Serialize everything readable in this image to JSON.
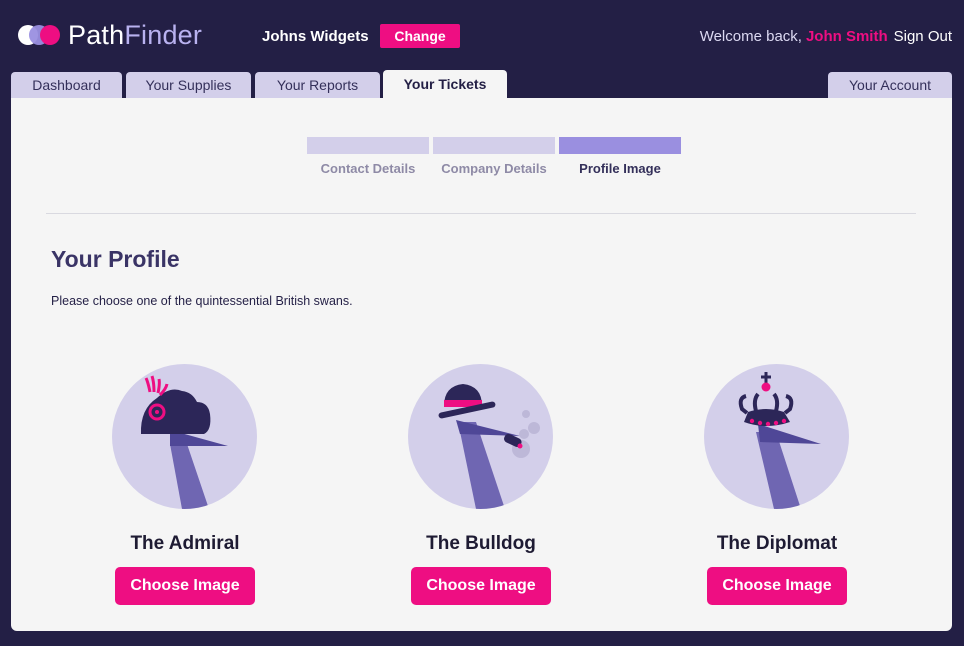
{
  "app": {
    "logo_part1": "Path",
    "logo_part2": "Finder",
    "company": "Johns Widgets",
    "change_label": "Change",
    "welcome_text": "Welcome back,",
    "user_name": "John Smith",
    "signout_label": "Sign Out"
  },
  "tabs": [
    {
      "label": "Dashboard",
      "active": false
    },
    {
      "label": "Your Supplies",
      "active": false
    },
    {
      "label": "Your Reports",
      "active": false
    },
    {
      "label": "Your Tickets",
      "active": true
    }
  ],
  "account_tab": {
    "label": "Your Account"
  },
  "steps": [
    {
      "label": "Contact Details",
      "active": false
    },
    {
      "label": "Company Details",
      "active": false
    },
    {
      "label": "Profile Image",
      "active": true
    }
  ],
  "profile": {
    "title": "Your Profile",
    "subtitle": "Please choose one of the quintessential British swans.",
    "options": [
      {
        "name": "The Admiral",
        "button": "Choose Image",
        "icon": "admiral-swan-icon"
      },
      {
        "name": "The Bulldog",
        "button": "Choose Image",
        "icon": "bulldog-swan-icon"
      },
      {
        "name": "The Diplomat",
        "button": "Choose Image",
        "icon": "diplomat-swan-icon"
      }
    ]
  },
  "colors": {
    "background": "#231f45",
    "accent": "#ee0e82",
    "lavender": "#d3cfea",
    "active_step": "#9a8fe0",
    "panel": "#f5f5f5"
  }
}
